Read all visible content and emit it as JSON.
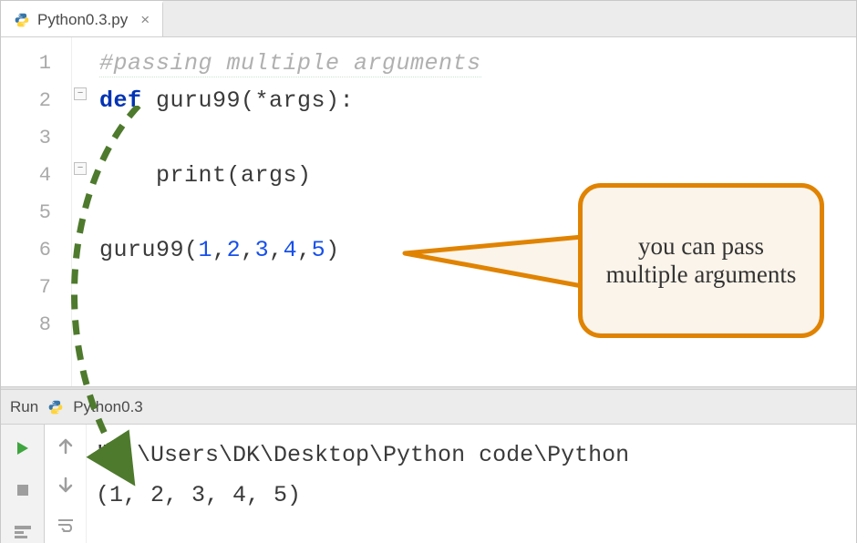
{
  "tab": {
    "filename": "Python0.3.py"
  },
  "code": {
    "lines": [
      {
        "n": 1
      },
      {
        "n": 2
      },
      {
        "n": 3
      },
      {
        "n": 4
      },
      {
        "n": 5
      },
      {
        "n": 6
      },
      {
        "n": 7
      },
      {
        "n": 8
      }
    ],
    "comment": "#passing multiple arguments",
    "kw_def": "def",
    "fn_name": "guru99",
    "args_param": "(*args)",
    "colon": ":",
    "print_call": "print",
    "print_args": "(args)",
    "call_fn": "guru99",
    "call_args_open": "(",
    "call_nums": [
      "1",
      "2",
      "3",
      "4",
      "5"
    ],
    "call_args_close": ")"
  },
  "callout": {
    "text": "you can pass multiple arguments"
  },
  "run": {
    "label": "Run",
    "config": "Python0.3"
  },
  "console": {
    "line1": "\"C:\\Users\\DK\\Desktop\\Python code\\Python",
    "line2": "(1, 2, 3, 4, 5)"
  },
  "icons": {
    "play": "play-icon",
    "stop": "stop-icon",
    "up": "arrow-up-icon",
    "down": "arrow-down-icon",
    "wrap": "wrap-icon"
  }
}
